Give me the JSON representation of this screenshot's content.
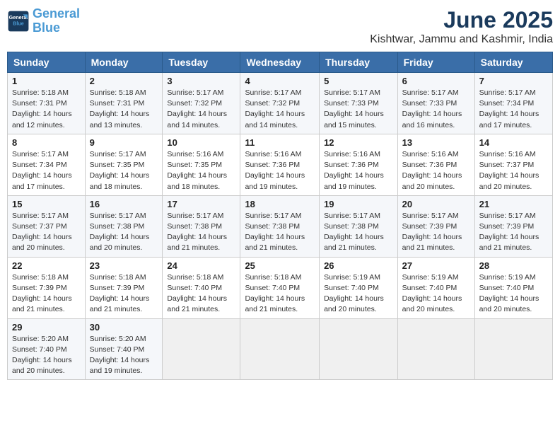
{
  "header": {
    "logo_line1": "General",
    "logo_line2": "Blue",
    "month": "June 2025",
    "location": "Kishtwar, Jammu and Kashmir, India"
  },
  "weekdays": [
    "Sunday",
    "Monday",
    "Tuesday",
    "Wednesday",
    "Thursday",
    "Friday",
    "Saturday"
  ],
  "weeks": [
    [
      {
        "day": "1",
        "lines": [
          "Sunrise: 5:18 AM",
          "Sunset: 7:31 PM",
          "Daylight: 14 hours",
          "and 12 minutes."
        ]
      },
      {
        "day": "2",
        "lines": [
          "Sunrise: 5:18 AM",
          "Sunset: 7:31 PM",
          "Daylight: 14 hours",
          "and 13 minutes."
        ]
      },
      {
        "day": "3",
        "lines": [
          "Sunrise: 5:17 AM",
          "Sunset: 7:32 PM",
          "Daylight: 14 hours",
          "and 14 minutes."
        ]
      },
      {
        "day": "4",
        "lines": [
          "Sunrise: 5:17 AM",
          "Sunset: 7:32 PM",
          "Daylight: 14 hours",
          "and 14 minutes."
        ]
      },
      {
        "day": "5",
        "lines": [
          "Sunrise: 5:17 AM",
          "Sunset: 7:33 PM",
          "Daylight: 14 hours",
          "and 15 minutes."
        ]
      },
      {
        "day": "6",
        "lines": [
          "Sunrise: 5:17 AM",
          "Sunset: 7:33 PM",
          "Daylight: 14 hours",
          "and 16 minutes."
        ]
      },
      {
        "day": "7",
        "lines": [
          "Sunrise: 5:17 AM",
          "Sunset: 7:34 PM",
          "Daylight: 14 hours",
          "and 17 minutes."
        ]
      }
    ],
    [
      {
        "day": "8",
        "lines": [
          "Sunrise: 5:17 AM",
          "Sunset: 7:34 PM",
          "Daylight: 14 hours",
          "and 17 minutes."
        ]
      },
      {
        "day": "9",
        "lines": [
          "Sunrise: 5:17 AM",
          "Sunset: 7:35 PM",
          "Daylight: 14 hours",
          "and 18 minutes."
        ]
      },
      {
        "day": "10",
        "lines": [
          "Sunrise: 5:16 AM",
          "Sunset: 7:35 PM",
          "Daylight: 14 hours",
          "and 18 minutes."
        ]
      },
      {
        "day": "11",
        "lines": [
          "Sunrise: 5:16 AM",
          "Sunset: 7:36 PM",
          "Daylight: 14 hours",
          "and 19 minutes."
        ]
      },
      {
        "day": "12",
        "lines": [
          "Sunrise: 5:16 AM",
          "Sunset: 7:36 PM",
          "Daylight: 14 hours",
          "and 19 minutes."
        ]
      },
      {
        "day": "13",
        "lines": [
          "Sunrise: 5:16 AM",
          "Sunset: 7:36 PM",
          "Daylight: 14 hours",
          "and 20 minutes."
        ]
      },
      {
        "day": "14",
        "lines": [
          "Sunrise: 5:16 AM",
          "Sunset: 7:37 PM",
          "Daylight: 14 hours",
          "and 20 minutes."
        ]
      }
    ],
    [
      {
        "day": "15",
        "lines": [
          "Sunrise: 5:17 AM",
          "Sunset: 7:37 PM",
          "Daylight: 14 hours",
          "and 20 minutes."
        ]
      },
      {
        "day": "16",
        "lines": [
          "Sunrise: 5:17 AM",
          "Sunset: 7:38 PM",
          "Daylight: 14 hours",
          "and 20 minutes."
        ]
      },
      {
        "day": "17",
        "lines": [
          "Sunrise: 5:17 AM",
          "Sunset: 7:38 PM",
          "Daylight: 14 hours",
          "and 21 minutes."
        ]
      },
      {
        "day": "18",
        "lines": [
          "Sunrise: 5:17 AM",
          "Sunset: 7:38 PM",
          "Daylight: 14 hours",
          "and 21 minutes."
        ]
      },
      {
        "day": "19",
        "lines": [
          "Sunrise: 5:17 AM",
          "Sunset: 7:38 PM",
          "Daylight: 14 hours",
          "and 21 minutes."
        ]
      },
      {
        "day": "20",
        "lines": [
          "Sunrise: 5:17 AM",
          "Sunset: 7:39 PM",
          "Daylight: 14 hours",
          "and 21 minutes."
        ]
      },
      {
        "day": "21",
        "lines": [
          "Sunrise: 5:17 AM",
          "Sunset: 7:39 PM",
          "Daylight: 14 hours",
          "and 21 minutes."
        ]
      }
    ],
    [
      {
        "day": "22",
        "lines": [
          "Sunrise: 5:18 AM",
          "Sunset: 7:39 PM",
          "Daylight: 14 hours",
          "and 21 minutes."
        ]
      },
      {
        "day": "23",
        "lines": [
          "Sunrise: 5:18 AM",
          "Sunset: 7:39 PM",
          "Daylight: 14 hours",
          "and 21 minutes."
        ]
      },
      {
        "day": "24",
        "lines": [
          "Sunrise: 5:18 AM",
          "Sunset: 7:40 PM",
          "Daylight: 14 hours",
          "and 21 minutes."
        ]
      },
      {
        "day": "25",
        "lines": [
          "Sunrise: 5:18 AM",
          "Sunset: 7:40 PM",
          "Daylight: 14 hours",
          "and 21 minutes."
        ]
      },
      {
        "day": "26",
        "lines": [
          "Sunrise: 5:19 AM",
          "Sunset: 7:40 PM",
          "Daylight: 14 hours",
          "and 20 minutes."
        ]
      },
      {
        "day": "27",
        "lines": [
          "Sunrise: 5:19 AM",
          "Sunset: 7:40 PM",
          "Daylight: 14 hours",
          "and 20 minutes."
        ]
      },
      {
        "day": "28",
        "lines": [
          "Sunrise: 5:19 AM",
          "Sunset: 7:40 PM",
          "Daylight: 14 hours",
          "and 20 minutes."
        ]
      }
    ],
    [
      {
        "day": "29",
        "lines": [
          "Sunrise: 5:20 AM",
          "Sunset: 7:40 PM",
          "Daylight: 14 hours",
          "and 20 minutes."
        ]
      },
      {
        "day": "30",
        "lines": [
          "Sunrise: 5:20 AM",
          "Sunset: 7:40 PM",
          "Daylight: 14 hours",
          "and 19 minutes."
        ]
      },
      {
        "day": "",
        "lines": []
      },
      {
        "day": "",
        "lines": []
      },
      {
        "day": "",
        "lines": []
      },
      {
        "day": "",
        "lines": []
      },
      {
        "day": "",
        "lines": []
      }
    ]
  ]
}
